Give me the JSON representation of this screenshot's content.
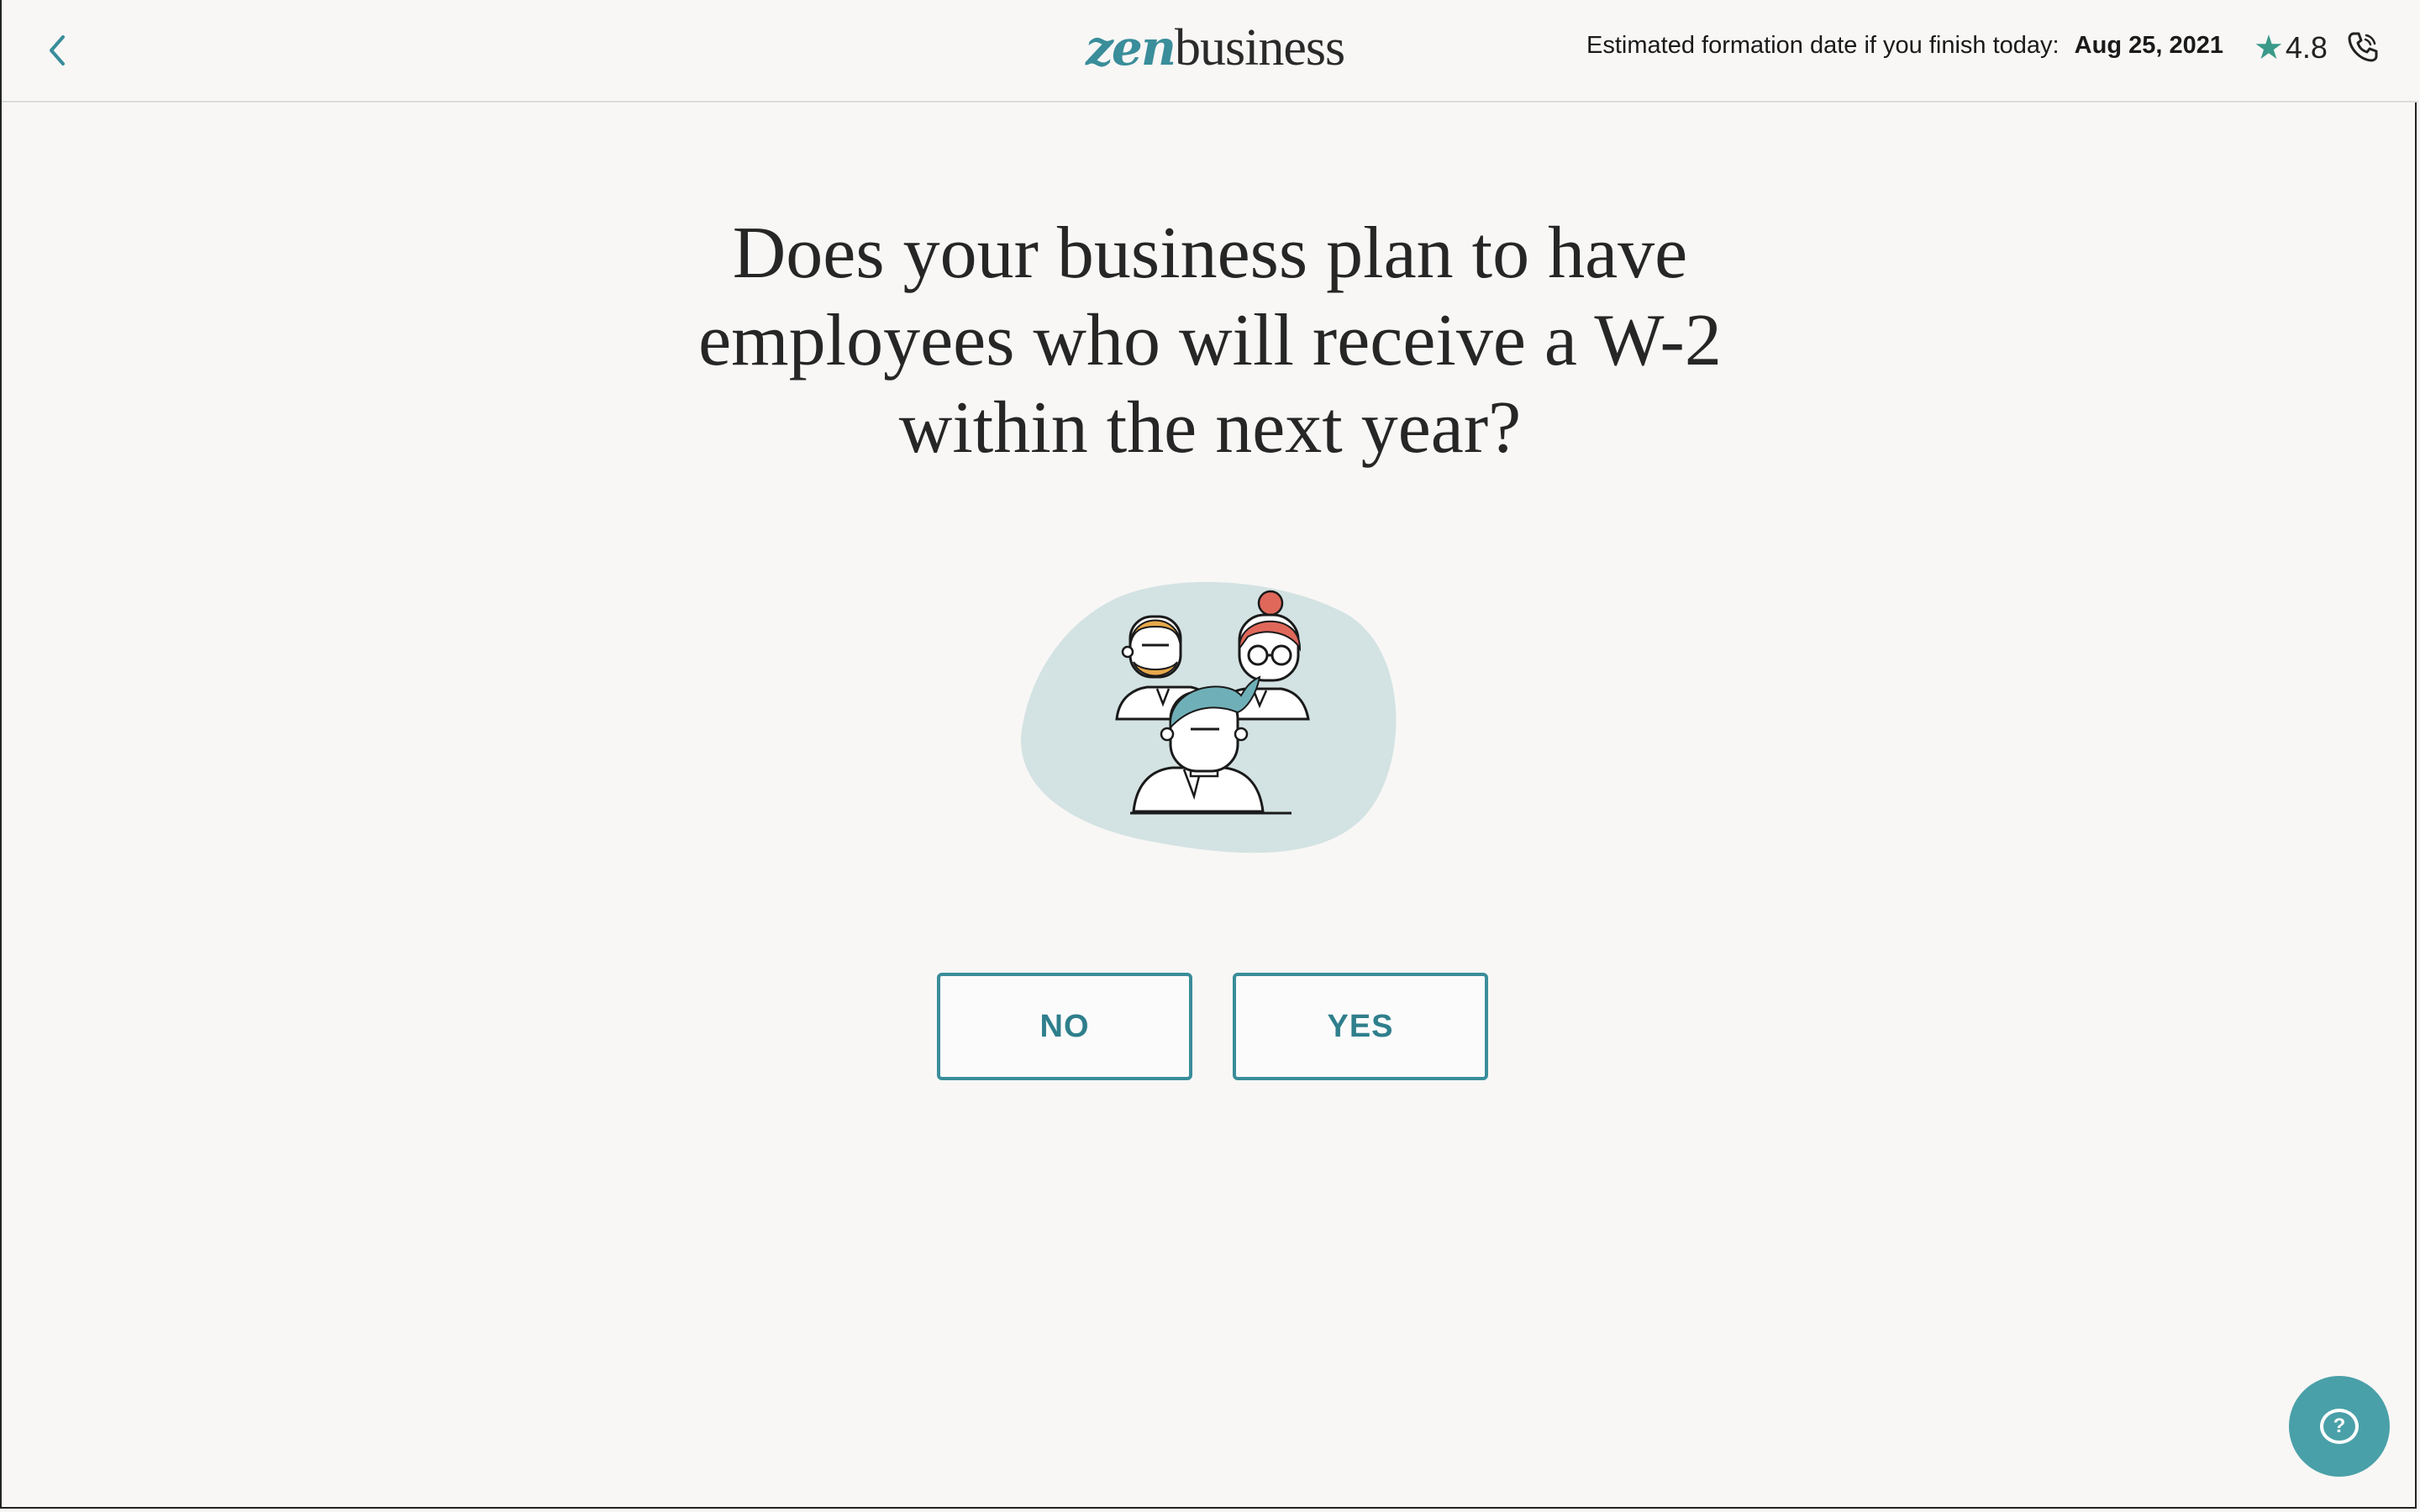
{
  "header": {
    "logo_part1": "zen",
    "logo_part2": "business",
    "formation_label": "Estimated formation date if you finish today:",
    "formation_date": "Aug 25, 2021",
    "rating": "4.8"
  },
  "question": {
    "lines": [
      "Does your business plan to have",
      "employees who will receive a W-2",
      "within the next year?"
    ]
  },
  "choices": {
    "no_label": "NO",
    "yes_label": "YES"
  },
  "help": {
    "icon_text": "?"
  },
  "colors": {
    "accent": "#3a8d9a",
    "background": "#f8f7f6",
    "help_button": "#4aa0a8",
    "star": "#3a9a8a"
  },
  "icons": {
    "back": "chevron-left-icon",
    "star": "star-icon",
    "phone": "phone-icon",
    "help": "chat-question-icon"
  }
}
